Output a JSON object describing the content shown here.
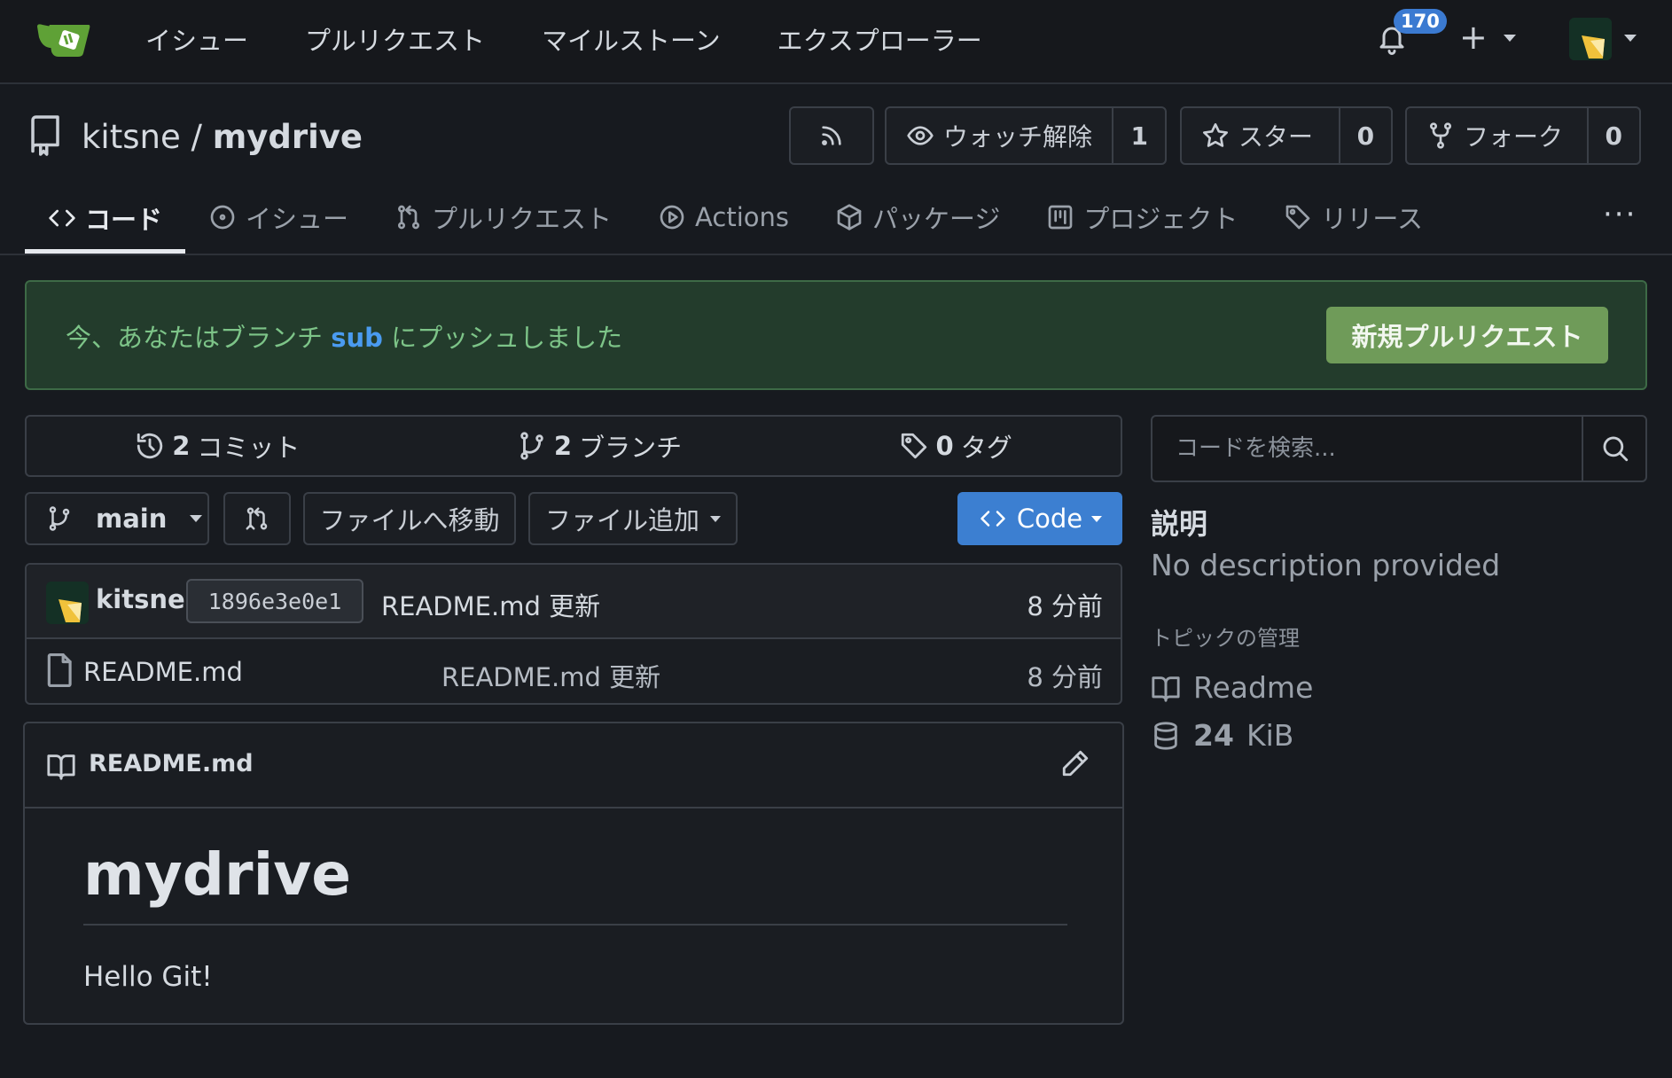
{
  "topnav": {
    "links": [
      "イシュー",
      "プルリクエスト",
      "マイルストーン",
      "エクスプローラー"
    ],
    "notification_count": "170"
  },
  "repo": {
    "owner": "kitsne",
    "separator": "/",
    "name": "mydrive"
  },
  "header_buttons": {
    "unwatch_label": "ウォッチ解除",
    "watch_count": "1",
    "star_label": "スター",
    "star_count": "0",
    "fork_label": "フォーク",
    "fork_count": "0"
  },
  "tabs": [
    {
      "label": "コード",
      "active": true
    },
    {
      "label": "イシュー"
    },
    {
      "label": "プルリクエスト"
    },
    {
      "label": "Actions"
    },
    {
      "label": "パッケージ"
    },
    {
      "label": "プロジェクト"
    },
    {
      "label": "リリース"
    }
  ],
  "banner": {
    "prefix": "今、あなたはブランチ",
    "branch": "sub",
    "suffix": "にプッシュしました",
    "new_pr_label": "新規プルリクエスト"
  },
  "stats": {
    "commits_count": "2",
    "commits_label": "コミット",
    "branches_count": "2",
    "branches_label": "ブランチ",
    "tags_count": "0",
    "tags_label": "タグ"
  },
  "toolbar": {
    "branch": "main",
    "goto_file_label": "ファイルへ移動",
    "add_file_label": "ファイル追加",
    "code_label": "Code"
  },
  "latest_commit": {
    "user": "kitsne",
    "sha": "1896e3e0e1",
    "message": "README.md 更新",
    "time": "8 分前"
  },
  "files": [
    {
      "name": "README.md",
      "message": "README.md 更新",
      "time": "8 分前"
    }
  ],
  "readme": {
    "filename": "README.md",
    "heading": "mydrive",
    "body": "Hello Git!"
  },
  "sidebar": {
    "search_placeholder": "コードを検索...",
    "description_heading": "説明",
    "description_text": "No description provided",
    "topics_label": "トピックの管理",
    "readme_label": "Readme",
    "size_value": "24",
    "size_unit": "KiB"
  },
  "colors": {
    "background": "#171a1f",
    "accent_blue": "#3c7fd1",
    "banner_bg": "#233c2c",
    "banner_text": "#7dc488",
    "new_pr_button": "#6f9b59"
  }
}
